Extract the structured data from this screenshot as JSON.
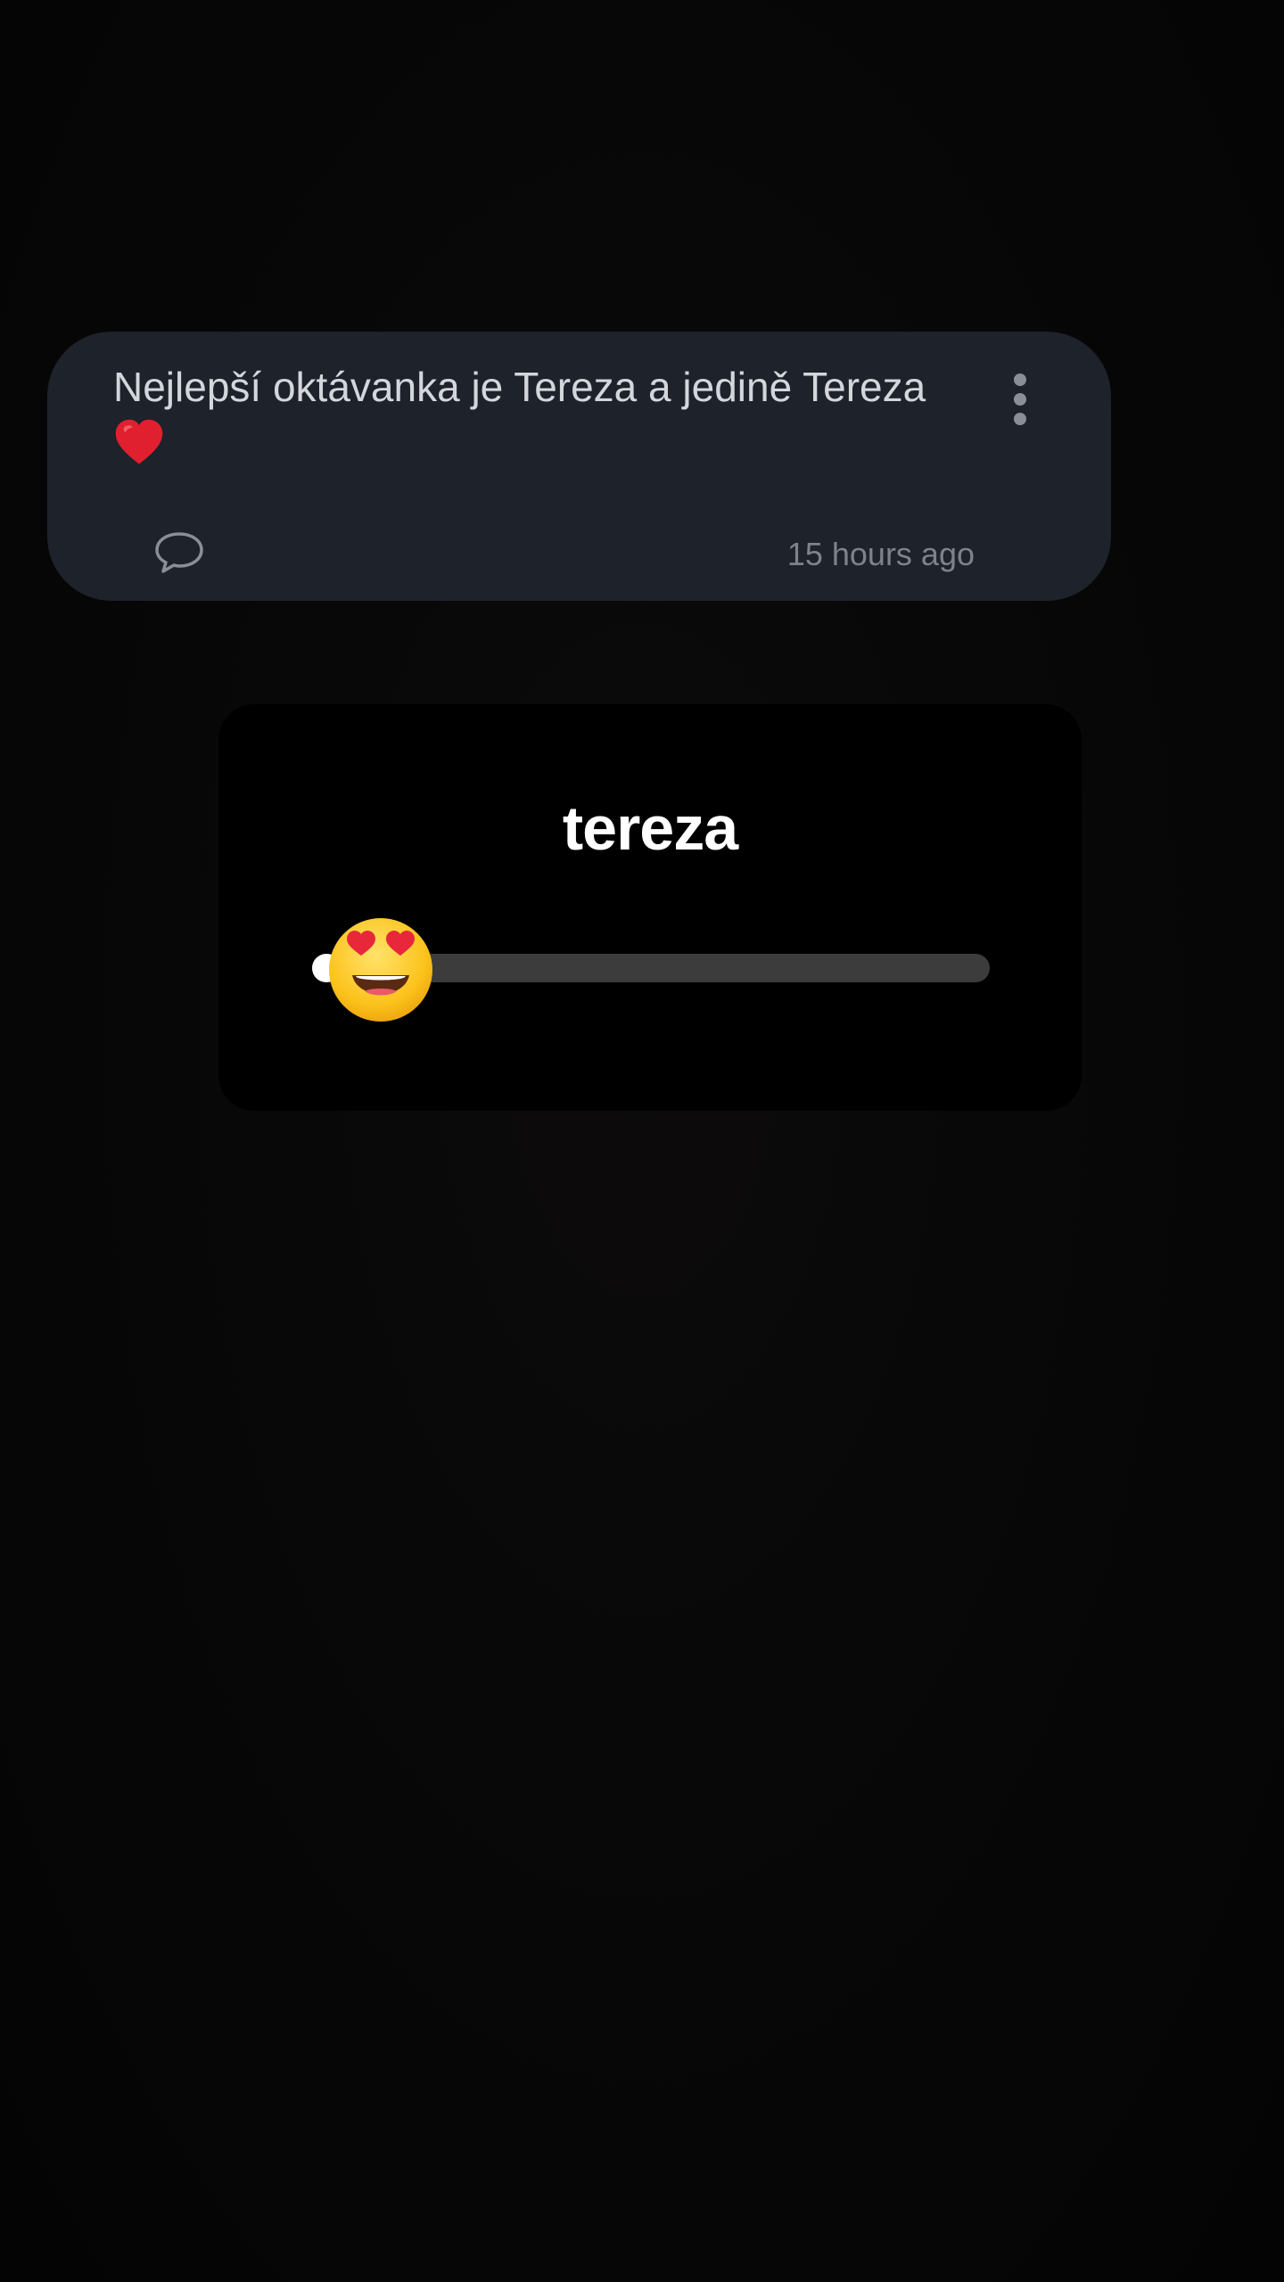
{
  "post": {
    "text": "Nejlepší oktávanka je Tereza a jedině Tereza",
    "trailing_emoji": "red-heart",
    "timestamp": "15 hours ago",
    "menu_icon": "more-vertical-icon",
    "comment_icon": "comment-bubble-icon"
  },
  "slider": {
    "question": "tereza",
    "emoji": "heart-eyes-face",
    "value_fraction": 0.02
  },
  "colors": {
    "card_background": "#1d222b",
    "page_background": "#050505",
    "slider_track": "#3c3c3c",
    "slider_fill": "#ffffff"
  }
}
